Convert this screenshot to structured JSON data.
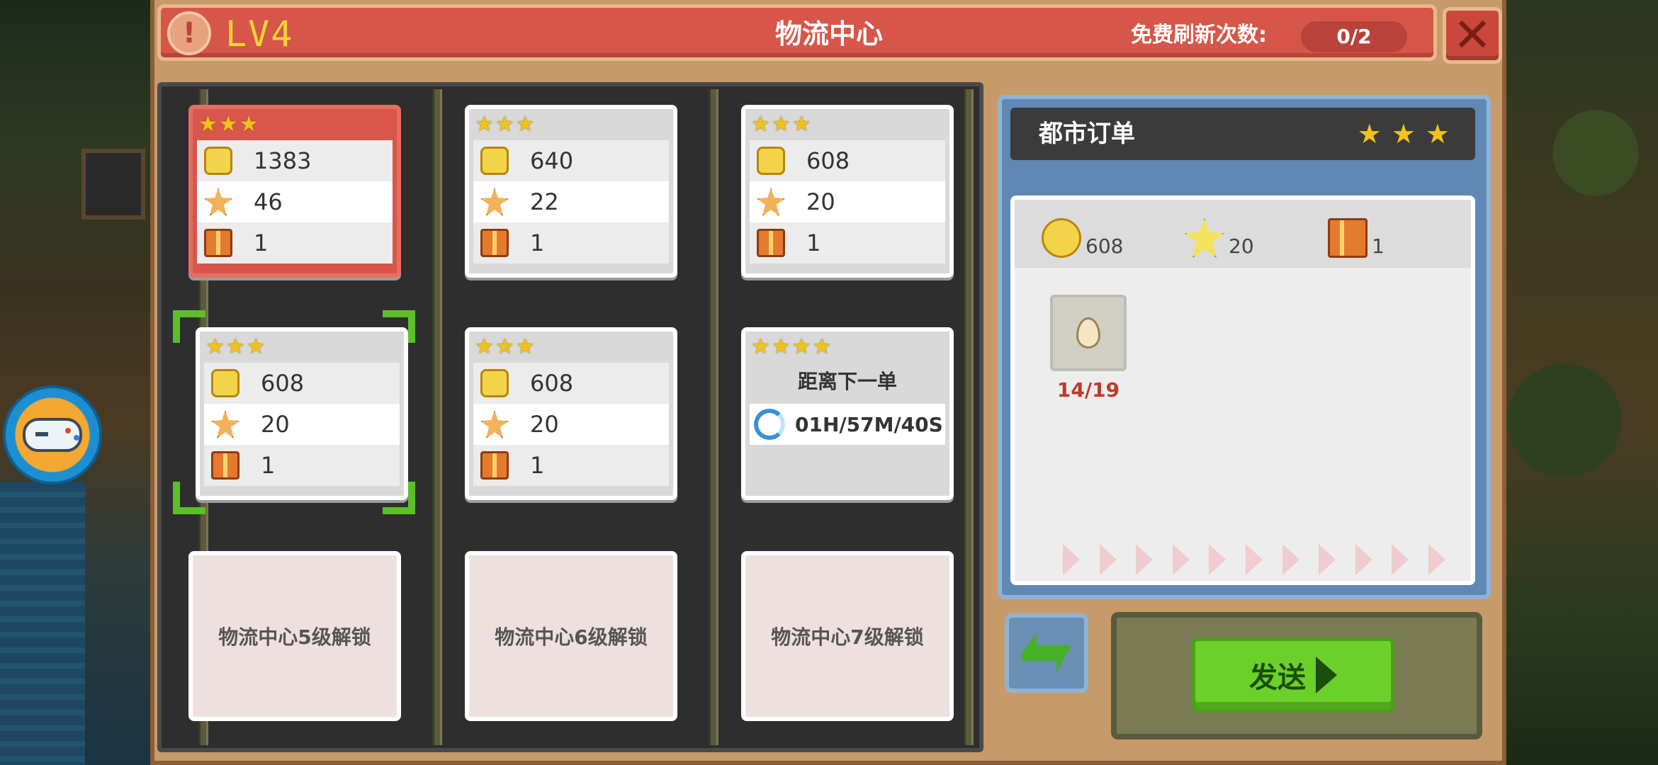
{
  "header": {
    "level": "LV4",
    "title": "物流中心",
    "refresh_label": "免费刷新次数:",
    "refresh_count": "0/2"
  },
  "orders": [
    {
      "stars": "★★★",
      "coins": "1383",
      "xp": "46",
      "gifts": "1",
      "selected": true
    },
    {
      "stars": "★★★",
      "coins": "640",
      "xp": "22",
      "gifts": "1"
    },
    {
      "stars": "★★★",
      "coins": "608",
      "xp": "20",
      "gifts": "1"
    },
    {
      "stars": "★★★",
      "coins": "608",
      "xp": "20",
      "gifts": "1"
    },
    {
      "stars": "★★★",
      "coins": "608",
      "xp": "20",
      "gifts": "1"
    }
  ],
  "timer_order": {
    "stars": "★★★★",
    "label": "距离下一单",
    "countdown": "01H/57M/40S"
  },
  "locked_slots": [
    "物流中心5级解锁",
    "物流中心6级解锁",
    "物流中心7级解锁"
  ],
  "detail": {
    "name": "都市订单",
    "stars": "★★★",
    "reward_coins": "608",
    "reward_xp": "20",
    "reward_gifts": "1",
    "item_icon": "egg-icon",
    "item_progress": "14/19",
    "send_label": "发送"
  },
  "colors": {
    "header_red": "#d6564a",
    "selected_card": "#d9564a",
    "send_green": "#6bd02a",
    "level_yellow": "#f6d33b",
    "progress_red": "#c0392b"
  }
}
